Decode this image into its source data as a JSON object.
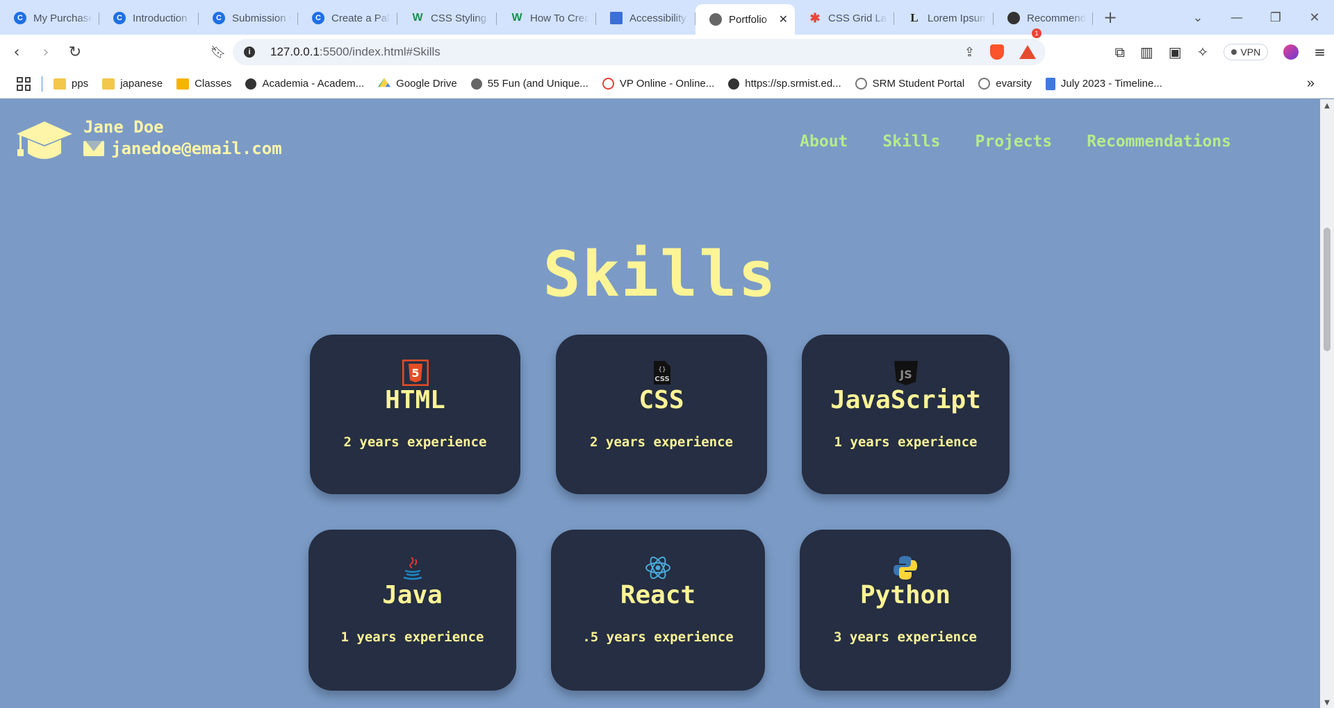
{
  "browser": {
    "tabs": [
      {
        "title": "My Purchases",
        "icon": "coursera-icon"
      },
      {
        "title": "Introduction",
        "icon": "coursera-icon"
      },
      {
        "title": "Submission Confirmation",
        "icon": "coursera-icon"
      },
      {
        "title": "Create a Palette",
        "icon": "coursera-icon"
      },
      {
        "title": "CSS Styling Lists",
        "icon": "wikihow-icon"
      },
      {
        "title": "How To Create",
        "icon": "wikihow-icon"
      },
      {
        "title": "Accessibility",
        "icon": "flag-icon"
      },
      {
        "title": "Portfolio",
        "icon": "globe-icon",
        "active": true
      },
      {
        "title": "CSS Grid Layout",
        "icon": "star-icon"
      },
      {
        "title": "Lorem Ipsum",
        "icon": "lorem-icon"
      },
      {
        "title": "Recommendations",
        "icon": "chatgpt-icon"
      }
    ],
    "url_host": "127.0.0.1",
    "url_rest": ":5500/index.html#Skills",
    "rewards_badge": "1",
    "vpn_label": "VPN",
    "bookmarks": [
      {
        "label": "pps",
        "icon": "folder-icon"
      },
      {
        "label": "japanese",
        "icon": "folder-icon"
      },
      {
        "label": "Classes",
        "icon": "classroom-icon"
      },
      {
        "label": "Academia - Academ...",
        "icon": "globe-icon"
      },
      {
        "label": "Google Drive",
        "icon": "drive-icon"
      },
      {
        "label": "55 Fun (and Unique...",
        "icon": "site-icon"
      },
      {
        "label": "VP Online - Online...",
        "icon": "vp-icon"
      },
      {
        "label": "https://sp.srmist.ed...",
        "icon": "globe-icon"
      },
      {
        "label": "SRM Student Portal",
        "icon": "srm-icon"
      },
      {
        "label": "evarsity",
        "icon": "srm-icon"
      },
      {
        "label": "July 2023 - Timeline...",
        "icon": "doc-icon"
      }
    ]
  },
  "site": {
    "name": "Jane Doe",
    "email": "janedoe@email.com",
    "nav": [
      "About",
      "Skills",
      "Projects",
      "Recommendations"
    ],
    "section_title": "Skills",
    "skills": [
      {
        "name": "HTML",
        "experience": "2 years experience",
        "icon": "html5-icon"
      },
      {
        "name": "CSS",
        "experience": "2 years experience",
        "icon": "css-icon"
      },
      {
        "name": "JavaScript",
        "experience": "1 years experience",
        "icon": "js-icon"
      },
      {
        "name": "Java",
        "experience": "1 years experience",
        "icon": "java-icon"
      },
      {
        "name": "React",
        "experience": ".5 years experience",
        "icon": "react-icon"
      },
      {
        "name": "Python",
        "experience": "3 years experience",
        "icon": "python-icon"
      }
    ]
  },
  "colors": {
    "page_bg": "#7b9bc6",
    "card_bg": "#252e42",
    "accent_yellow": "#fdf496",
    "nav_green": "#b7ec8a"
  }
}
